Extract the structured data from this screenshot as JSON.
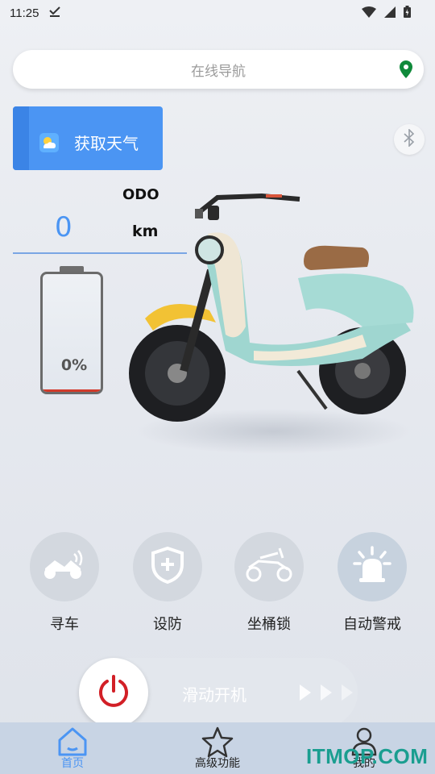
{
  "status_bar": {
    "time": "11:25"
  },
  "search": {
    "placeholder": "在线导航"
  },
  "weather_button": {
    "label": "获取天气"
  },
  "odometer": {
    "title": "ODO",
    "value": "0",
    "unit": "km"
  },
  "battery": {
    "percent_label": "0%",
    "level": 0.02
  },
  "functions": [
    {
      "label": "寻车",
      "icon": "scooter-sound-icon"
    },
    {
      "label": "设防",
      "icon": "shield-plus-icon"
    },
    {
      "label": "坐桶锁",
      "icon": "scooter-seat-icon"
    },
    {
      "label": "自动警戒",
      "icon": "alarm-light-icon"
    }
  ],
  "slider": {
    "label": "滑动开机"
  },
  "tabs": [
    {
      "label": "首页",
      "icon": "home-icon",
      "active": true
    },
    {
      "label": "高级功能",
      "icon": "star-icon",
      "active": false
    },
    {
      "label": "我的",
      "icon": "person-icon",
      "active": false
    }
  ],
  "watermark": "ITMOP.COM",
  "colors": {
    "accent": "#4b95f3",
    "power": "#d21f26",
    "tabbar": "#c8d4e4",
    "watermark": "#1a9e90"
  }
}
